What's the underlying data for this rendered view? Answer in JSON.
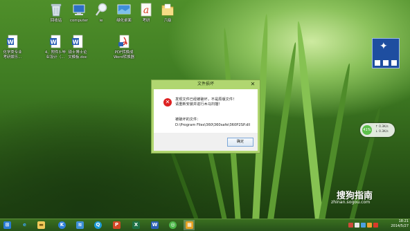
{
  "desktop_icons": [
    {
      "label": "回收站",
      "icon": "recycle-bin-icon"
    },
    {
      "label": "computer",
      "icon": "computer-icon"
    },
    {
      "label": "ie",
      "icon": "magnifier-icon"
    },
    {
      "label": "绿化桌面",
      "icon": "monitor-icon"
    },
    {
      "label": "考研",
      "icon": "a-letter-icon"
    },
    {
      "label": "六级",
      "icon": "folder-icon"
    },
    {
      "label": "化学类专业\n考研娱乐...",
      "icon": "word-doc-icon"
    },
    {
      "label": "4、附件3-毕\n业设计（...",
      "icon": "word-doc-icon"
    },
    {
      "label": "硕士博士论\n文模板.doc",
      "icon": "word-doc-icon"
    },
    {
      "label": "PDF转换成\nWord转换器",
      "icon": "pdf-converter-icon"
    }
  ],
  "dialog": {
    "title": "文件损坏",
    "close_symbol": "✕",
    "message_line1": "发现文件已经被破坏，不是原版文件！",
    "message_line2": "请重新安装并进行木马扫描！",
    "damaged_label": "被破坏的文件：",
    "damaged_path": "D:\\Program Files\\360\\360safe\\360P2SP.dll",
    "ok_label": "确定"
  },
  "gadget": {
    "percent": "41%",
    "upload": "0.3K/s",
    "download": "0.3K/s"
  },
  "watermark": {
    "text": "搜狗指南",
    "url": "zhinan.sogou.com"
  },
  "taskbar": {
    "items": [
      {
        "name": "windows-start-icon",
        "glyph": "⊞"
      },
      {
        "name": "ie-browser-icon",
        "glyph": "e"
      },
      {
        "name": "file-explorer-icon",
        "glyph": "▬"
      },
      {
        "name": "k-app-icon",
        "glyph": "K"
      },
      {
        "name": "network-app-icon",
        "glyph": "≋"
      },
      {
        "name": "qq-icon",
        "glyph": "Q"
      },
      {
        "name": "powerpoint-icon",
        "glyph": "P"
      },
      {
        "name": "excel-icon",
        "glyph": "X"
      },
      {
        "name": "word-icon",
        "glyph": "W"
      },
      {
        "name": "security-app-icon",
        "glyph": "◎"
      },
      {
        "name": "tiles-app-icon",
        "glyph": "▦"
      }
    ],
    "clock_time": "18:21",
    "clock_date": "2014/5/27"
  },
  "colors": {
    "dialog_frame": "#b0d670",
    "taskbar": "#2f5e1b",
    "error_red": "#dd2222"
  }
}
